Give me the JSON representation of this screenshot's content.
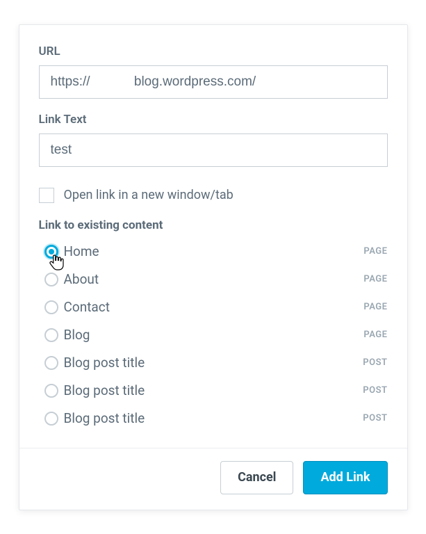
{
  "url_field": {
    "label": "URL",
    "value": "https://            blog.wordpress.com/"
  },
  "link_text_field": {
    "label": "Link Text",
    "value": "test"
  },
  "new_tab_checkbox": {
    "label": "Open link in a new window/tab",
    "checked": false
  },
  "existing_content": {
    "heading": "Link to existing content",
    "items": [
      {
        "label": "Home",
        "type": "PAGE",
        "selected": true
      },
      {
        "label": "About",
        "type": "PAGE",
        "selected": false
      },
      {
        "label": "Contact",
        "type": "PAGE",
        "selected": false
      },
      {
        "label": "Blog",
        "type": "PAGE",
        "selected": false
      },
      {
        "label": "Blog post title",
        "type": "POST",
        "selected": false
      },
      {
        "label": "Blog post title",
        "type": "POST",
        "selected": false
      },
      {
        "label": "Blog post title",
        "type": "POST",
        "selected": false
      }
    ]
  },
  "actions": {
    "cancel": "Cancel",
    "submit": "Add Link"
  }
}
